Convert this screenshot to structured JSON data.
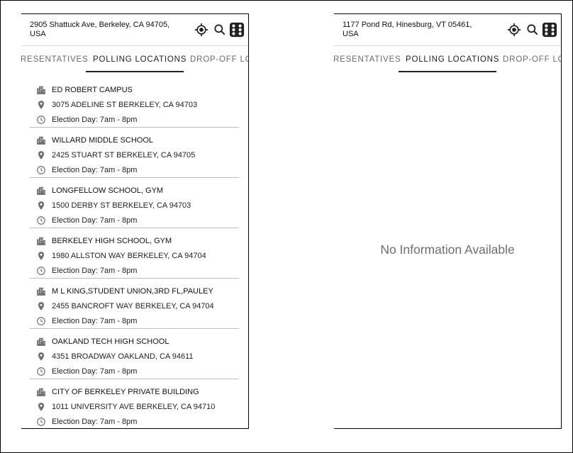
{
  "colors": {
    "text": "#222222",
    "muted": "#6a6a6a",
    "icon": "#6f6f6f",
    "divider": "#bdbdbd"
  },
  "left_screen": {
    "address": "2905 Shattuck Ave, Berkeley, CA 94705, USA",
    "icons": [
      "my-location-icon",
      "search-icon",
      "dice-icon"
    ],
    "tabs": [
      {
        "label": "RESENTATIVES"
      },
      {
        "label": "POLLING LOCATIONS",
        "active": true
      },
      {
        "label": "DROP-OFF LOC"
      }
    ],
    "locations": [
      {
        "name": "ED ROBERT CAMPUS",
        "address": "3075 ADELINE ST BERKELEY, CA 94703",
        "hours": "Election Day: 7am - 8pm"
      },
      {
        "name": "WILLARD MIDDLE SCHOOL",
        "address": "2425 STUART ST BERKELEY, CA 94705",
        "hours": "Election Day: 7am - 8pm"
      },
      {
        "name": "LONGFELLOW SCHOOL, GYM",
        "address": "1500 DERBY ST BERKELEY, CA 94703",
        "hours": "Election Day: 7am - 8pm"
      },
      {
        "name": "BERKELEY HIGH SCHOOL, GYM",
        "address": "1980 ALLSTON WAY BERKELEY, CA 94704",
        "hours": "Election Day: 7am - 8pm"
      },
      {
        "name": "M L KING,STUDENT UNION,3RD FL,PAULEY",
        "address": "2455 BANCROFT WAY BERKELEY, CA 94704",
        "hours": "Election Day: 7am - 8pm"
      },
      {
        "name": "OAKLAND TECH HIGH SCHOOL",
        "address": "4351 BROADWAY OAKLAND, CA 94611",
        "hours": "Election Day: 7am - 8pm"
      },
      {
        "name": "CITY OF BERKELEY PRIVATE BUILDING",
        "address": "1011 UNIVERSITY AVE BERKELEY, CA 94710",
        "hours": "Election Day: 7am - 8pm"
      }
    ],
    "row_icons": [
      "building-icon",
      "map-pin-icon",
      "clock-icon"
    ]
  },
  "right_screen": {
    "address": "1177 Pond Rd, Hinesburg, VT 05461, USA",
    "tabs": [
      {
        "label": "RESENTATIVES"
      },
      {
        "label": "POLLING LOCATIONS",
        "active": true
      },
      {
        "label": "DROP-OFF LOC"
      }
    ],
    "empty_message": "No Information Available"
  }
}
